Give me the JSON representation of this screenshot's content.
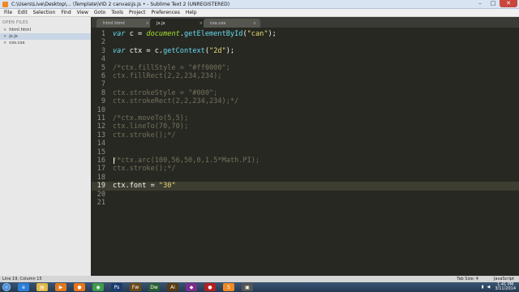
{
  "window": {
    "title": "C:\\Users\\Live\\Desktop\\... \\Template\\VID 2 canvas\\js.js • - Sublime Text 2 (UNREGISTERED)",
    "minimize": "–",
    "maximize": "□",
    "close": "✕"
  },
  "menu": [
    "File",
    "Edit",
    "Selection",
    "Find",
    "View",
    "Goto",
    "Tools",
    "Project",
    "Preferences",
    "Help"
  ],
  "sidebar": {
    "header": "OPEN FILES",
    "files": [
      {
        "name": "html.html",
        "close": "×"
      },
      {
        "name": "js.js",
        "close": "×"
      },
      {
        "name": "css.css",
        "close": "×"
      }
    ]
  },
  "tabs": [
    {
      "name": "html.html",
      "close": "×"
    },
    {
      "name": "js.js",
      "close": "×"
    },
    {
      "name": "css.css",
      "close": "×"
    }
  ],
  "editor": {
    "current_line": 19,
    "lines": [
      {
        "n": "1",
        "seg": [
          {
            "t": "var ",
            "c": "kw"
          },
          {
            "t": "c = "
          },
          {
            "t": "document",
            "c": "id"
          },
          {
            "t": "."
          },
          {
            "t": "getElementById",
            "c": "fn"
          },
          {
            "t": "("
          },
          {
            "t": "\"can\"",
            "c": "str"
          },
          {
            "t": ");"
          }
        ]
      },
      {
        "n": "2",
        "seg": []
      },
      {
        "n": "3",
        "seg": [
          {
            "t": "var ",
            "c": "kw"
          },
          {
            "t": "ctx = c."
          },
          {
            "t": "getContext",
            "c": "fn"
          },
          {
            "t": "("
          },
          {
            "t": "\"2d\"",
            "c": "str"
          },
          {
            "t": ");"
          }
        ]
      },
      {
        "n": "4",
        "seg": []
      },
      {
        "n": "5",
        "seg": [
          {
            "t": "/*ctx.fillStyle = \"#ff0000\";",
            "c": "cm"
          }
        ]
      },
      {
        "n": "6",
        "seg": [
          {
            "t": "ctx.fillRect(2,2,234,234);",
            "c": "cm"
          }
        ]
      },
      {
        "n": "7",
        "seg": []
      },
      {
        "n": "8",
        "seg": [
          {
            "t": "ctx.strokeStyle = \"#000\";",
            "c": "cm"
          }
        ]
      },
      {
        "n": "9",
        "seg": [
          {
            "t": "ctx.strokeRect(2,2,234,234);*/",
            "c": "cm"
          }
        ]
      },
      {
        "n": "10",
        "seg": []
      },
      {
        "n": "11",
        "seg": [
          {
            "t": "/*ctx.moveTo(5,5);",
            "c": "cm"
          }
        ]
      },
      {
        "n": "12",
        "seg": [
          {
            "t": "ctx.lineTo(70,70);",
            "c": "cm"
          }
        ]
      },
      {
        "n": "13",
        "seg": [
          {
            "t": "ctx.stroke();*/",
            "c": "cm"
          }
        ]
      },
      {
        "n": "14",
        "seg": []
      },
      {
        "n": "15",
        "seg": []
      },
      {
        "n": "16",
        "seg": [
          {
            "t": "/*ctx.arc(100,56,50,0,1.5*Math.PI);",
            "c": "cm"
          }
        ]
      },
      {
        "n": "17",
        "seg": [
          {
            "t": "ctx.stroke();*/",
            "c": "cm"
          }
        ]
      },
      {
        "n": "18",
        "seg": []
      },
      {
        "n": "19",
        "seg": [
          {
            "t": "ctx.font = "
          },
          {
            "t": "\"30\"",
            "c": "str"
          }
        ]
      },
      {
        "n": "20",
        "seg": []
      },
      {
        "n": "21",
        "seg": []
      }
    ]
  },
  "status": {
    "position": "Line 19, Column 15",
    "tab_size": "Tab Size: 4",
    "syntax": "JavaScript"
  },
  "taskbar": {
    "apps": [
      {
        "name": "Internet Explorer",
        "icon": "e",
        "color": "#2c7fd8"
      },
      {
        "name": "File Explorer",
        "icon": "▤",
        "color": "#e0b84a"
      },
      {
        "name": "Media Player",
        "icon": "▶",
        "color": "#e07a1f"
      },
      {
        "name": "Firefox",
        "icon": "●",
        "color": "#e8761c"
      },
      {
        "name": "Chrome",
        "icon": "◉",
        "color": "#3f9b4a"
      },
      {
        "name": "Photoshop",
        "icon": "Ps",
        "color": "#1b3d6d"
      },
      {
        "name": "Fireworks",
        "icon": "Fw",
        "color": "#6b4b1c"
      },
      {
        "name": "Dreamweaver",
        "icon": "Dw",
        "color": "#2a5e35"
      },
      {
        "name": "Illustrator",
        "icon": "Ai",
        "color": "#5a3a12"
      },
      {
        "name": "App",
        "icon": "◆",
        "color": "#7a2e8c"
      },
      {
        "name": "Recorder",
        "icon": "●",
        "color": "#b32020"
      },
      {
        "name": "Sublime Text",
        "icon": "S",
        "color": "#f08a24"
      },
      {
        "name": "App 2",
        "icon": "▣",
        "color": "#555"
      }
    ],
    "time": "1:41 PM",
    "date": "3/11/2014"
  }
}
